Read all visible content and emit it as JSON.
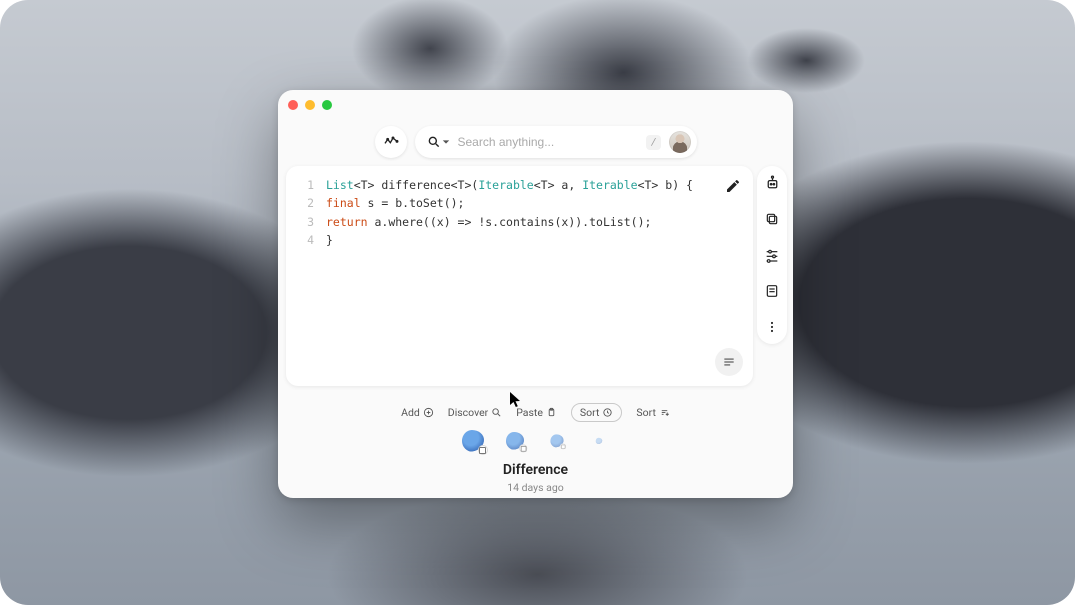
{
  "search": {
    "placeholder": "Search anything...",
    "shortcut": "/"
  },
  "code": {
    "lines": [
      {
        "n": "1",
        "tokens": [
          {
            "t": "List",
            "c": "tok-type"
          },
          {
            "t": "<T> difference<T>(",
            "c": ""
          },
          {
            "t": "Iterable",
            "c": "tok-type"
          },
          {
            "t": "<T> a, ",
            "c": ""
          },
          {
            "t": "Iterable",
            "c": "tok-type"
          },
          {
            "t": "<T> b) {",
            "c": ""
          }
        ]
      },
      {
        "n": "2",
        "tokens": [
          {
            "t": "  ",
            "c": ""
          },
          {
            "t": "final",
            "c": "tok-kw"
          },
          {
            "t": " s = b.toSet();",
            "c": ""
          }
        ]
      },
      {
        "n": "3",
        "tokens": [
          {
            "t": "  ",
            "c": ""
          },
          {
            "t": "return",
            "c": "tok-kw"
          },
          {
            "t": " a.where((x) => !s.contains(x)).toList();",
            "c": ""
          }
        ]
      },
      {
        "n": "4",
        "tokens": [
          {
            "t": "}",
            "c": ""
          }
        ]
      }
    ]
  },
  "actions": {
    "add": "Add",
    "discover": "Discover",
    "paste": "Paste",
    "sort_pill": "Sort",
    "sort": "Sort"
  },
  "item": {
    "title": "Difference",
    "subtitle": "14 days ago"
  }
}
